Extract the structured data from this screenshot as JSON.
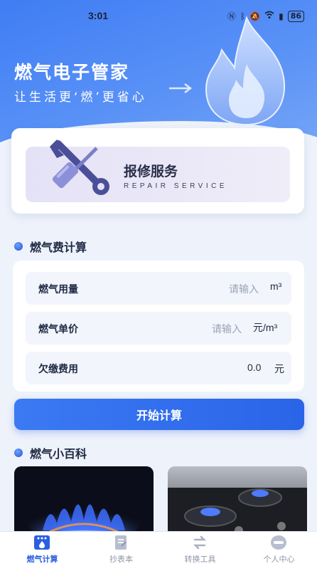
{
  "status_bar": {
    "time": "3:01",
    "battery": "86"
  },
  "header": {
    "title": "燃气电子管家",
    "slogan": "让生活更‘燃’更省心"
  },
  "repair": {
    "title": "报修服务",
    "subtitle": "REPAIR SERVICE"
  },
  "calc": {
    "section_title": "燃气费计算",
    "rows": [
      {
        "label": "燃气用量",
        "placeholder": "请输入",
        "unit": "m³"
      },
      {
        "label": "燃气单价",
        "placeholder": "请输入",
        "unit": "元/m³"
      },
      {
        "label": "欠缴费用",
        "value": "0.0",
        "unit": "元"
      }
    ],
    "button": "开始计算"
  },
  "wiki": {
    "section_title": "燃气小百科"
  },
  "tabs": [
    {
      "label": "燃气计算",
      "icon": "stove-icon",
      "active": true
    },
    {
      "label": "抄表本",
      "icon": "notebook-icon",
      "active": false
    },
    {
      "label": "转换工具",
      "icon": "convert-icon",
      "active": false
    },
    {
      "label": "个人中心",
      "icon": "profile-icon",
      "active": false
    }
  ],
  "colors": {
    "primary": "#2a64e8",
    "hero": "#3f7df4",
    "background": "#eef2fa"
  }
}
